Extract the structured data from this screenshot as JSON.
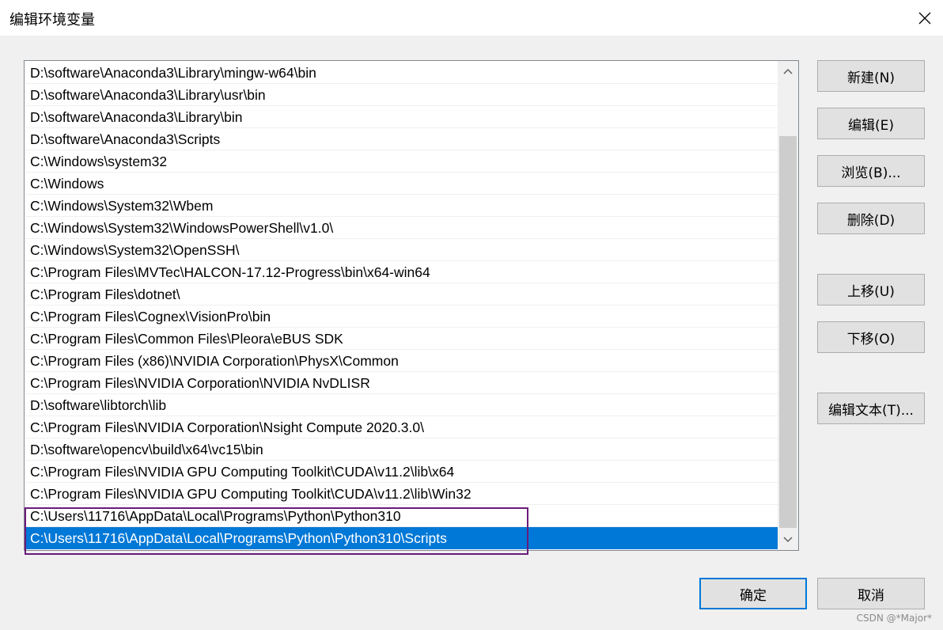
{
  "window": {
    "title": "编辑环境变量"
  },
  "paths": [
    "D:\\software\\Anaconda3\\Library\\mingw-w64\\bin",
    "D:\\software\\Anaconda3\\Library\\usr\\bin",
    "D:\\software\\Anaconda3\\Library\\bin",
    "D:\\software\\Anaconda3\\Scripts",
    "C:\\Windows\\system32",
    "C:\\Windows",
    "C:\\Windows\\System32\\Wbem",
    "C:\\Windows\\System32\\WindowsPowerShell\\v1.0\\",
    "C:\\Windows\\System32\\OpenSSH\\",
    "C:\\Program Files\\MVTec\\HALCON-17.12-Progress\\bin\\x64-win64",
    "C:\\Program Files\\dotnet\\",
    "C:\\Program Files\\Cognex\\VisionPro\\bin",
    "C:\\Program Files\\Common Files\\Pleora\\eBUS SDK",
    "C:\\Program Files (x86)\\NVIDIA Corporation\\PhysX\\Common",
    "C:\\Program Files\\NVIDIA Corporation\\NVIDIA NvDLISR",
    "D:\\software\\libtorch\\lib",
    "C:\\Program Files\\NVIDIA Corporation\\Nsight Compute 2020.3.0\\",
    "D:\\software\\opencv\\build\\x64\\vc15\\bin",
    "C:\\Program Files\\NVIDIA GPU Computing Toolkit\\CUDA\\v11.2\\lib\\x64",
    "C:\\Program Files\\NVIDIA GPU Computing Toolkit\\CUDA\\v11.2\\lib\\Win32",
    "C:\\Users\\11716\\AppData\\Local\\Programs\\Python\\Python310",
    "C:\\Users\\11716\\AppData\\Local\\Programs\\Python\\Python310\\Scripts"
  ],
  "selected_index": 21,
  "buttons": {
    "new": "新建(N)",
    "edit": "编辑(E)",
    "browse": "浏览(B)...",
    "delete": "删除(D)",
    "move_up": "上移(U)",
    "move_down": "下移(O)",
    "edit_text": "编辑文本(T)...",
    "ok": "确定",
    "cancel": "取消"
  },
  "icons": {
    "close": "close-icon",
    "scroll_up": "chevron-up-icon",
    "scroll_down": "chevron-down-icon"
  },
  "colors": {
    "selection": "#0078d7",
    "annotation_box": "#6a1b7a"
  },
  "watermark": "CSDN @*Major*"
}
